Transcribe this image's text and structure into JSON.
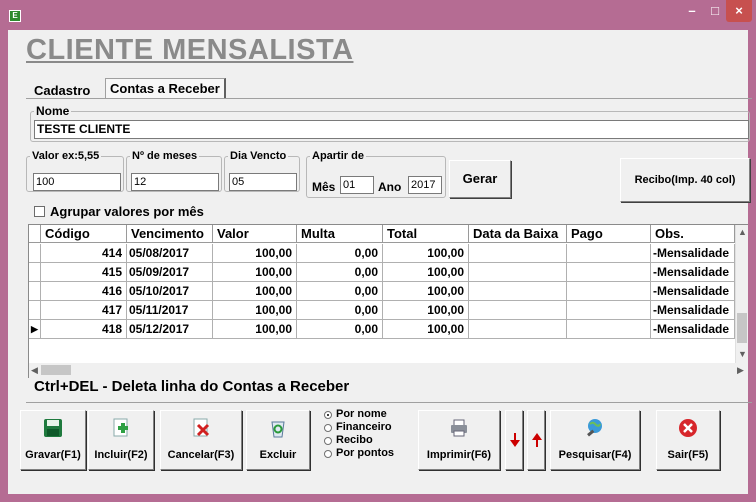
{
  "window": {
    "icon_letter": "E",
    "minimize": "–",
    "maximize": "□",
    "close": "×"
  },
  "title": "CLIENTE MENSALISTA",
  "tabs": [
    {
      "label": "Cadastro"
    },
    {
      "label": "Contas a Receber"
    }
  ],
  "nome": {
    "label": "Nome",
    "value": "TESTE CLIENTE"
  },
  "fields": {
    "valor": {
      "label": "Valor  ex:5,55",
      "value": "100"
    },
    "meses": {
      "label": "Nº de meses",
      "value": "12"
    },
    "dia": {
      "label": "Dia Vencto",
      "value": "05"
    },
    "apartir": {
      "label": "Apartir de",
      "mes_label": "Mês",
      "mes_value": "01",
      "ano_label": "Ano",
      "ano_value": "2017"
    }
  },
  "buttons": {
    "gerar": "Gerar",
    "recibo": "Recibo(Imp. 40 col)"
  },
  "agrupar_label": "Agrupar valores por mês",
  "grid": {
    "columns": [
      "Código",
      "Vencimento",
      "Valor",
      "Multa",
      "Total",
      "Data da Baixa",
      "Pago",
      "Obs."
    ],
    "rows": [
      {
        "codigo": "414",
        "vencimento": "05/08/2017",
        "valor": "100,00",
        "multa": "0,00",
        "total": "100,00",
        "baixa": "",
        "pago": "",
        "obs": "-Mensalidade"
      },
      {
        "codigo": "415",
        "vencimento": "05/09/2017",
        "valor": "100,00",
        "multa": "0,00",
        "total": "100,00",
        "baixa": "",
        "pago": "",
        "obs": "-Mensalidade"
      },
      {
        "codigo": "416",
        "vencimento": "05/10/2017",
        "valor": "100,00",
        "multa": "0,00",
        "total": "100,00",
        "baixa": "",
        "pago": "",
        "obs": "-Mensalidade"
      },
      {
        "codigo": "417",
        "vencimento": "05/11/2017",
        "valor": "100,00",
        "multa": "0,00",
        "total": "100,00",
        "baixa": "",
        "pago": "",
        "obs": "-Mensalidade"
      },
      {
        "codigo": "418",
        "vencimento": "05/12/2017",
        "valor": "100,00",
        "multa": "0,00",
        "total": "100,00",
        "baixa": "",
        "pago": "",
        "obs": "-Mensalidade"
      }
    ]
  },
  "hint": "Ctrl+DEL - Deleta linha do Contas a Receber",
  "toolbar": {
    "gravar": "Gravar(F1)",
    "incluir": "Incluir(F2)",
    "cancelar": "Cancelar(F3)",
    "excluir": "Excluir",
    "imprimir": "Imprimir(F6)",
    "pesquisar": "Pesquisar(F4)",
    "sair": "Sair(F5)"
  },
  "radio_options": [
    "Por nome",
    "Financeiro",
    "Recibo",
    "Por pontos"
  ],
  "colors": {
    "titlebar": "#b56c93",
    "heading": "#8a8a8a",
    "down_arrow": "#cc0000",
    "up_arrow": "#cc0000"
  }
}
